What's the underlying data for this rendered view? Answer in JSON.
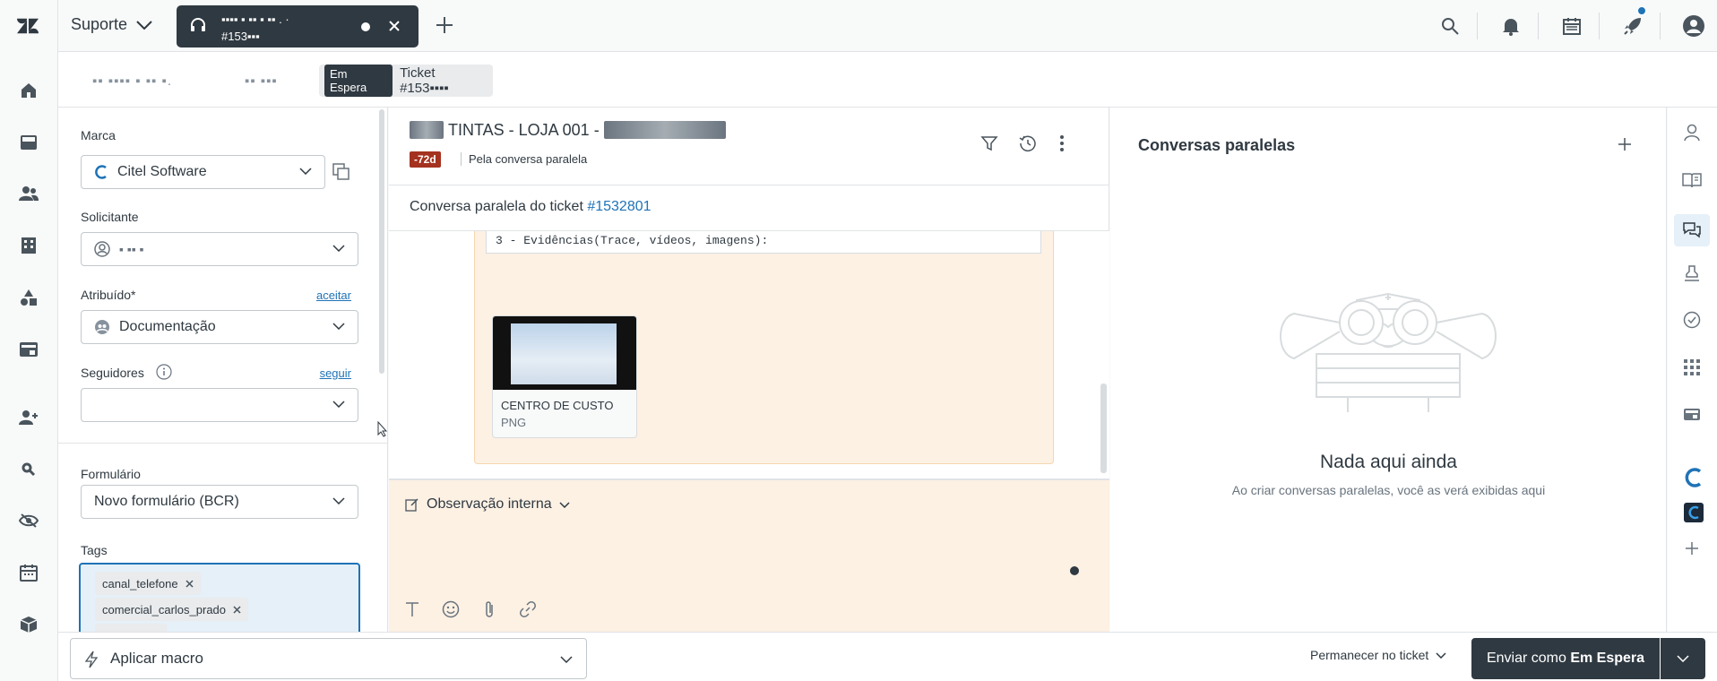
{
  "topbar": {
    "product": "Suporte",
    "call_tab": {
      "line1": "▪▪▪▪ ▪ ▪▪ ▪ ▪▪ . ·",
      "line2": "#153▪▪▪"
    }
  },
  "tabs": [
    {
      "label": "▪▪ ▪▪▪▪ ▪ ▪▪ ▪."
    },
    {
      "label": "▪▪ ▪▪▪"
    },
    {
      "badge": "Em Espera",
      "label": "Ticket #153▪▪▪▪"
    }
  ],
  "props": {
    "marca_label": "Marca",
    "marca_value": "Citel Software",
    "solicitante_label": "Solicitante",
    "solicitante_value": "▪ ▪▪ ▪",
    "atribuido_label": "Atribuído*",
    "atribuido_link": "aceitar",
    "atribuido_value": "Documentação",
    "seguidores_label": "Seguidores",
    "seguidores_link": "seguir",
    "formulario_label": "Formulário",
    "formulario_value": "Novo formulário (BCR)",
    "tags_label": "Tags",
    "tags": [
      "canal_telefone",
      "comercial_carlos_prado",
      "▪▪▪▪▪▪ ▪▪▪▪▪▪▪"
    ]
  },
  "ticket": {
    "title_prefix": "▪▪▪▪▪▪",
    "title_main": " TINTAS - LOJA 001 - ",
    "title_suffix": "▪▪▪▪▪ ▪ ▪▪▪▪▪ ▪▪▪▪▪▪▪▪",
    "age_badge": "-72d",
    "via": "Pela conversa paralela",
    "parallel_text": "Conversa paralela do ticket ",
    "parallel_link": "#1532801",
    "code_text": "3 - Evidências(Trace, vídeos, imagens):",
    "attachment_name": "CENTRO DE CUSTO",
    "attachment_ext": "PNG",
    "composer_mode": "Observação interna"
  },
  "side_conversations": {
    "title": "Conversas paralelas",
    "empty_title": "Nada aqui ainda",
    "empty_text": "Ao criar conversas paralelas, você as verá exibidas aqui"
  },
  "bottom": {
    "macro_label": "Aplicar macro",
    "stay_label": "Permanecer no ticket",
    "send_prefix": "Enviar como ",
    "send_status": "Em Espera"
  },
  "colors": {
    "accent": "#1f73b7",
    "dark": "#2f3941",
    "on_hold": "#2f3941",
    "age_badge": "#a4321f",
    "internal_note_bg": "#fdf1e4",
    "notification_dot": "#1f73b7"
  }
}
